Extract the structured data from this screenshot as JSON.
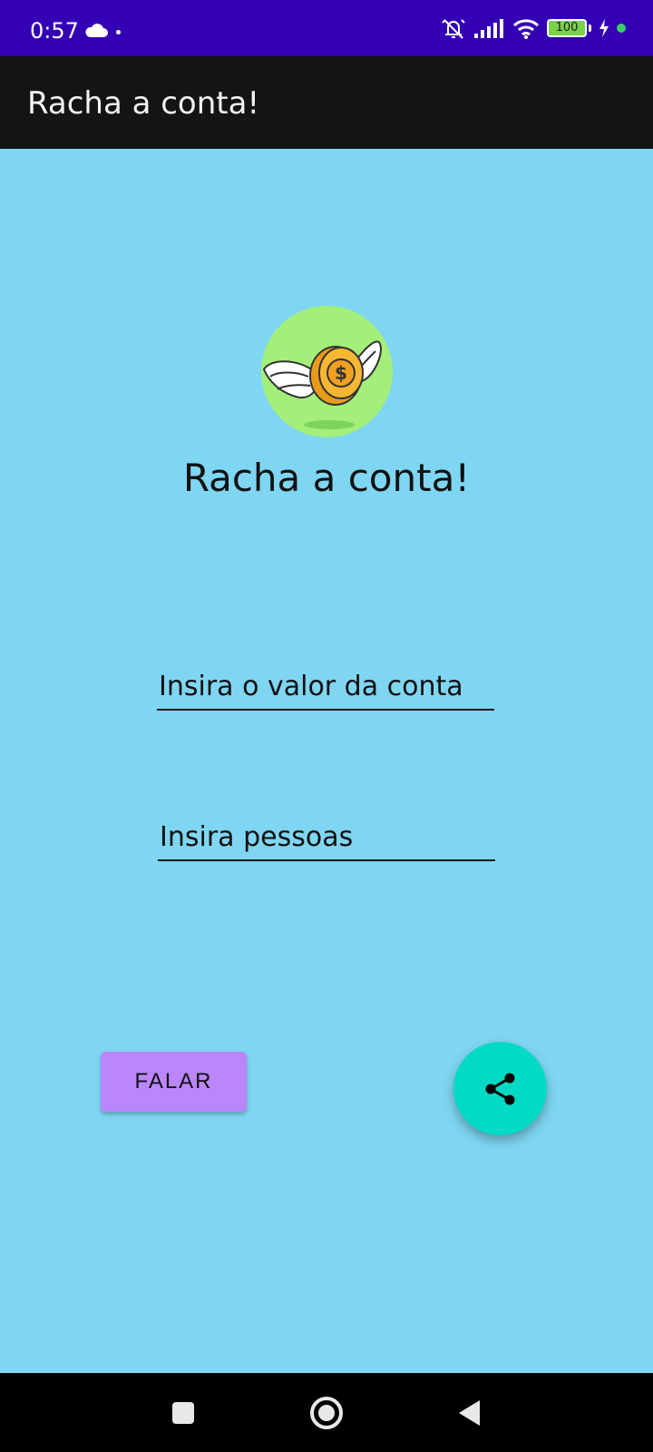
{
  "status_bar": {
    "time": "0:57",
    "battery_level": "100",
    "icons": [
      "cloud-icon",
      "dot-icon",
      "mute-alarm-icon",
      "signal-icon",
      "wifi-icon",
      "battery-icon",
      "charging-icon",
      "green-dot-icon"
    ]
  },
  "app_bar": {
    "title": "Racha a conta!"
  },
  "main": {
    "logo_icon": "winged-coin-icon",
    "headline": "Racha a conta!",
    "valor_placeholder": "Insira o valor da conta",
    "pessoas_placeholder": "Insira pessoas",
    "falar_label": "FALAR",
    "share_icon": "share-icon"
  },
  "nav_bar": {
    "icons": [
      "recents-icon",
      "home-icon",
      "back-icon"
    ]
  },
  "colors": {
    "status_bar": "#3300b3",
    "app_bar": "#141414",
    "background": "#7fd6f2",
    "button": "#bb86fc",
    "fab": "#03dac5",
    "logo_bg": "#a3ef7a"
  }
}
